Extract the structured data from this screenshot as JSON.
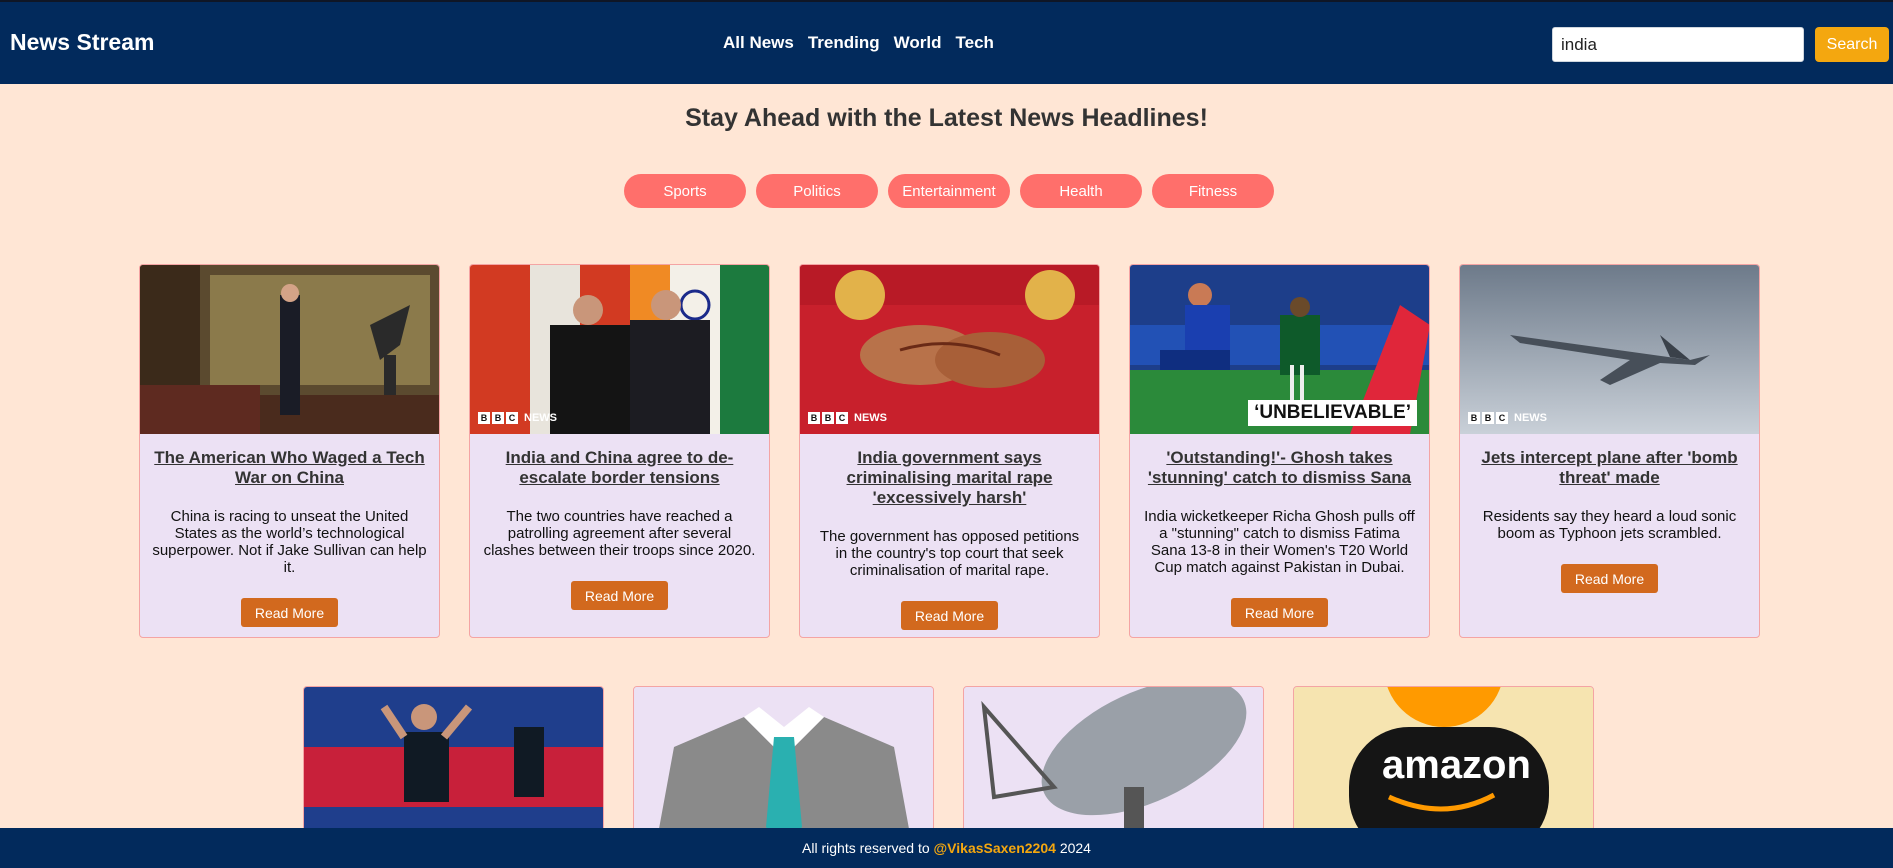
{
  "navbar": {
    "brand": "News Stream",
    "links": [
      "All News",
      "Trending",
      "World",
      "Tech"
    ],
    "search_value": "india",
    "search_button": "Search"
  },
  "headline": "Stay Ahead with the Latest News Headlines!",
  "categories": [
    "Sports",
    "Politics",
    "Entertainment",
    "Health",
    "Fitness"
  ],
  "cards": [
    {
      "title": "The American Who Waged a Tech War on China",
      "desc": "China is racing to unseat the United States as the world’s technological superpower. Not if Jake Sullivan can help it.",
      "button": "Read More"
    },
    {
      "title": "India and China agree to de-escalate border tensions",
      "desc": "The two countries have reached a patrolling agreement after several clashes between their troops since 2020.",
      "button": "Read More",
      "badge": "NEWS"
    },
    {
      "title": "India government says criminalising marital rape 'excessively harsh'",
      "desc": "The government has opposed petitions in the country's top court that seek criminalisation of marital rape.",
      "button": "Read More",
      "badge": "NEWS"
    },
    {
      "title": "'Outstanding!'- Ghosh takes 'stunning' catch to dismiss Sana",
      "desc": "India wicketkeeper Richa Ghosh pulls off a \"stunning\" catch to dismiss Fatima Sana 13-8 in their Women's T20 World Cup match against Pakistan in Dubai.",
      "button": "Read More",
      "overlay": "‘UNBELIEVABLE’"
    },
    {
      "title": "Jets intercept plane after 'bomb threat' made",
      "desc": "Residents say they heard a loud sonic boom as Typhoon jets scrambled.",
      "button": "Read More",
      "badge": "NEWS"
    }
  ],
  "second_row": {
    "amazon_text": "amazon"
  },
  "footer": {
    "prefix": "All rights reserved to",
    "handle": "@VikasSaxen2204",
    "year": "2024"
  }
}
